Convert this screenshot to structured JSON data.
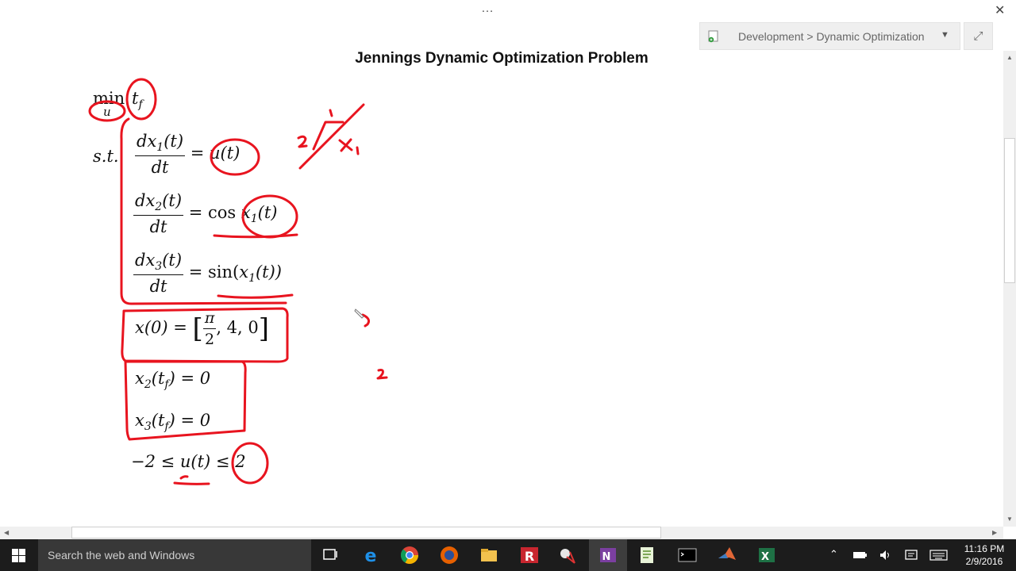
{
  "window": {
    "menu_dots": "…",
    "close_glyph": "✕",
    "notebook_location": "Development > Dynamic Optimization",
    "expand_glyph": "⤢"
  },
  "page": {
    "title": "Jennings Dynamic Optimization Problem"
  },
  "math": {
    "min_text": "min",
    "min_sub": "u",
    "objective": "t",
    "objective_sub": "f",
    "st": "s.t.",
    "eq1": {
      "num": "dx",
      "num_sub": "1",
      "num_tail": "(t)",
      "den": "dt",
      "rhs": "= u(t)"
    },
    "eq2": {
      "num": "dx",
      "num_sub": "2",
      "num_tail": "(t)",
      "den": "dt",
      "rhs_pre": "= cos ",
      "rhs_var": "x",
      "rhs_sub": "1",
      "rhs_tail": "(t)"
    },
    "eq3": {
      "num": "dx",
      "num_sub": "3",
      "num_tail": "(t)",
      "den": "dt",
      "rhs_pre": "= sin(",
      "rhs_var": "x",
      "rhs_sub": "1",
      "rhs_tail": "(t))"
    },
    "ic": {
      "lhs": "x(0) = ",
      "frac_num": "π",
      "frac_den": "2",
      "tail": ", 4, 0"
    },
    "term1": {
      "var": "x",
      "sub": "2",
      "mid": "(t",
      "mid_sub": "f",
      "tail": ") = 0"
    },
    "term2": {
      "var": "x",
      "sub": "3",
      "mid": "(t",
      "mid_sub": "f",
      "tail": ") = 0"
    },
    "bound": "−2 ≤ u(t) ≤ 2"
  },
  "taskbar": {
    "search_placeholder": "Search the web and Windows",
    "time": "11:16 PM",
    "date": "2/9/2016"
  },
  "colors": {
    "ink": "#e8141f",
    "taskbar": "#1c1c1c",
    "notebook_bar": "#efefef"
  }
}
